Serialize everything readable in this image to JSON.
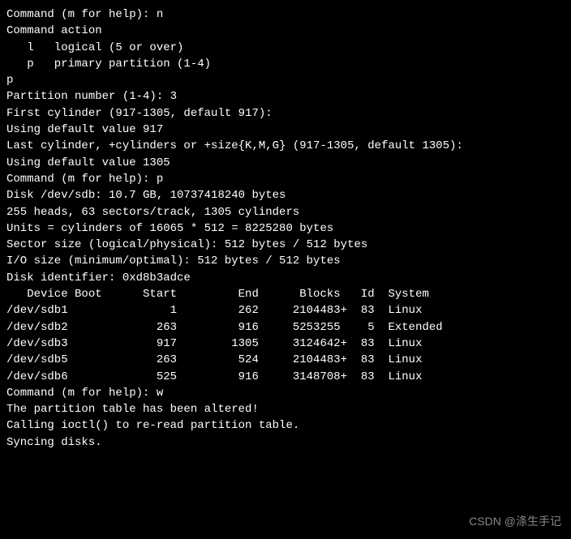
{
  "lines": {
    "l1": "Command (m for help): n",
    "l2": "Command action",
    "l3": "   l   logical (5 or over)",
    "l4": "   p   primary partition (1-4)",
    "l5": "p",
    "l6": "Partition number (1-4): 3",
    "l7": "First cylinder (917-1305, default 917):",
    "l8": "Using default value 917",
    "l9": "Last cylinder, +cylinders or +size{K,M,G} (917-1305, default 1305):",
    "l10": "Using default value 1305",
    "l11": "",
    "l12": "Command (m for help): p",
    "l13": "",
    "l14": "Disk /dev/sdb: 10.7 GB, 10737418240 bytes",
    "l15": "255 heads, 63 sectors/track, 1305 cylinders",
    "l16": "Units = cylinders of 16065 * 512 = 8225280 bytes",
    "l17": "Sector size (logical/physical): 512 bytes / 512 bytes",
    "l18": "I/O size (minimum/optimal): 512 bytes / 512 bytes",
    "l19": "Disk identifier: 0xd8b3adce",
    "l20": "",
    "l26": "",
    "l27": "Command (m for help): w",
    "l28": "The partition table has been altered!",
    "l29": "",
    "l30": "Calling ioctl() to re-read partition table.",
    "l31": "Syncing disks."
  },
  "table": {
    "header": "   Device Boot      Start         End      Blocks   Id  System",
    "rows": [
      "/dev/sdb1               1         262     2104483+  83  Linux",
      "/dev/sdb2             263         916     5253255    5  Extended",
      "/dev/sdb3             917        1305     3124642+  83  Linux",
      "/dev/sdb5             263         524     2104483+  83  Linux",
      "/dev/sdb6             525         916     3148708+  83  Linux"
    ]
  },
  "watermark": "CSDN @涤生手记",
  "chart_data": {
    "type": "table",
    "title": "fdisk partition table for /dev/sdb",
    "columns": [
      "Device",
      "Boot",
      "Start",
      "End",
      "Blocks",
      "Id",
      "System"
    ],
    "rows": [
      {
        "Device": "/dev/sdb1",
        "Boot": "",
        "Start": 1,
        "End": 262,
        "Blocks": "2104483+",
        "Id": "83",
        "System": "Linux"
      },
      {
        "Device": "/dev/sdb2",
        "Boot": "",
        "Start": 263,
        "End": 916,
        "Blocks": "5253255",
        "Id": "5",
        "System": "Extended"
      },
      {
        "Device": "/dev/sdb3",
        "Boot": "",
        "Start": 917,
        "End": 1305,
        "Blocks": "3124642+",
        "Id": "83",
        "System": "Linux"
      },
      {
        "Device": "/dev/sdb5",
        "Boot": "",
        "Start": 263,
        "End": 524,
        "Blocks": "2104483+",
        "Id": "83",
        "System": "Linux"
      },
      {
        "Device": "/dev/sdb6",
        "Boot": "",
        "Start": 525,
        "End": 916,
        "Blocks": "3148708+",
        "Id": "83",
        "System": "Linux"
      }
    ]
  }
}
